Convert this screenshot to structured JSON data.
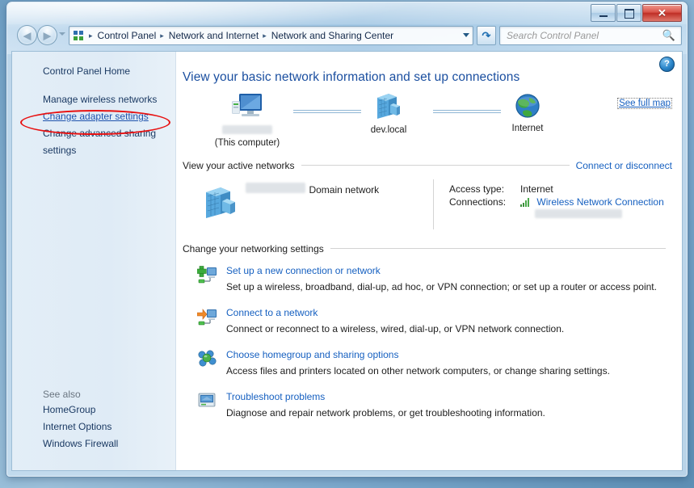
{
  "window": {
    "title": "Network and Sharing Center",
    "caption_buttons": {
      "minimize": "Minimize",
      "maximize": "Maximize",
      "close": "✕"
    }
  },
  "nav": {
    "back_label": "Back",
    "forward_label": "Forward",
    "history_label": "Recent pages",
    "breadcrumbs": [
      "Control Panel",
      "Network and Internet",
      "Network and Sharing Center"
    ],
    "separator": "▸",
    "address_dropdown_label": "Previous locations",
    "refresh_label": "Refresh",
    "search": {
      "placeholder": "Search Control Panel",
      "value": "",
      "icon": "search-icon"
    }
  },
  "sidebar": {
    "home_label": "Control Panel Home",
    "items": [
      {
        "label": "Manage wireless networks",
        "style": "plain"
      },
      {
        "label": "Change adapter settings",
        "style": "blue"
      },
      {
        "label": "Change advanced sharing",
        "style": "plain"
      },
      {
        "label": "settings",
        "style": "plain"
      }
    ],
    "see_also_label": "See also",
    "see_also": [
      {
        "label": "HomeGroup"
      },
      {
        "label": "Internet Options"
      },
      {
        "label": "Windows Firewall"
      }
    ],
    "highlight": {
      "target": "Change adapter settings",
      "color": "#e81010",
      "shape": "ellipse"
    }
  },
  "content": {
    "help_icon": "?",
    "page_title": "View your basic network information and set up connections",
    "see_full_map": "See full map",
    "map": {
      "nodes": [
        {
          "name": "computer-node",
          "label_redacted": true,
          "label": "",
          "sub": "(This computer)",
          "icon": "computer-icon"
        },
        {
          "name": "domain-node",
          "label": "dev.local",
          "sub": "",
          "icon": "server-icon"
        },
        {
          "name": "internet-node",
          "label": "Internet",
          "sub": "",
          "icon": "globe-icon"
        }
      ]
    },
    "active_networks": {
      "heading": "View your active networks",
      "action": "Connect or disconnect",
      "network": {
        "name_redacted": true,
        "name": "",
        "type": "Domain network",
        "icon": "server-icon"
      },
      "access_type_label": "Access type:",
      "access_type_value": "Internet",
      "connections_label": "Connections:",
      "connection_name": "Wireless Network Connection",
      "connection_icon": "signal-bars-icon",
      "ssid_redacted": true,
      "ssid": ""
    },
    "networking_settings": {
      "heading": "Change your networking settings",
      "items": [
        {
          "icon": "add-connection-icon",
          "link": "Set up a new connection or network",
          "description": "Set up a wireless, broadband, dial-up, ad hoc, or VPN connection; or set up a router or access point."
        },
        {
          "icon": "connect-network-icon",
          "link": "Connect to a network",
          "description": "Connect or reconnect to a wireless, wired, dial-up, or VPN network connection."
        },
        {
          "icon": "homegroup-icon",
          "link": "Choose homegroup and sharing options",
          "description": "Access files and printers located on other network computers, or change sharing settings."
        },
        {
          "icon": "troubleshoot-icon",
          "link": "Troubleshoot problems",
          "description": "Diagnose and repair network problems, or get troubleshooting information."
        }
      ]
    }
  },
  "colors": {
    "link": "#1660c0",
    "heading": "#1b4fa0",
    "highlight": "#e81010",
    "close_button": "#bf2f26"
  }
}
